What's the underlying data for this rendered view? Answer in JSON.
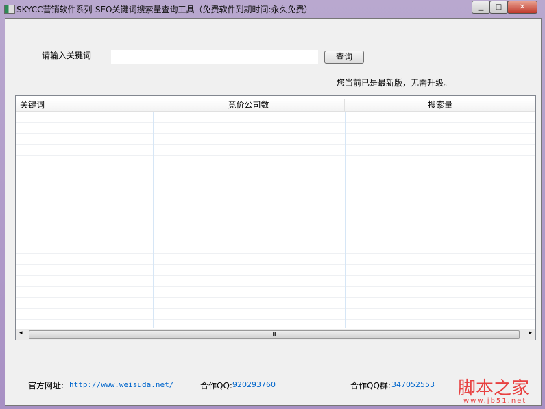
{
  "window": {
    "title": "SKYCC营销软件系列-SEO关键词搜索量查询工具（免费软件到期时间:永久免费）",
    "minimize": "▁",
    "maximize": "□",
    "close": "✕"
  },
  "form": {
    "keyword_label": "请输入关键词",
    "keyword_value": "",
    "search_button": "查询",
    "status": "您当前已是最新版，无需升级。"
  },
  "table": {
    "columns": [
      "关键词",
      "竞价公司数",
      "搜索量"
    ],
    "rows": []
  },
  "footer": {
    "site_label": "官方网址:",
    "site_link": "http://www.weisuda.net/",
    "qq_label": "合作QQ:",
    "qq_value": "920293760",
    "group_label": "合作QQ群:",
    "group_value": "347052553"
  },
  "watermark": {
    "text": "脚本之家",
    "url": "www.jb51.net"
  }
}
